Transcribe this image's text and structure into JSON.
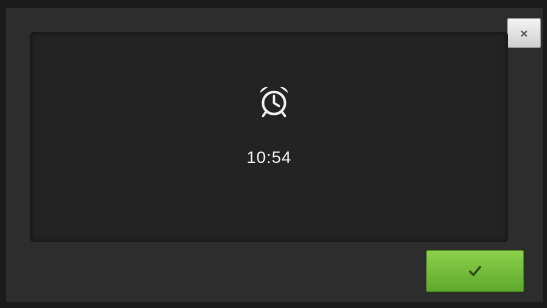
{
  "dialog": {
    "close_label": "×",
    "time": "10:54",
    "alarm_icon": "alarm-clock-icon",
    "ok_icon": "checkmark-icon"
  },
  "colors": {
    "ok_button": "#6cb637",
    "background": "#2c2d2c",
    "panel": "#222322"
  }
}
